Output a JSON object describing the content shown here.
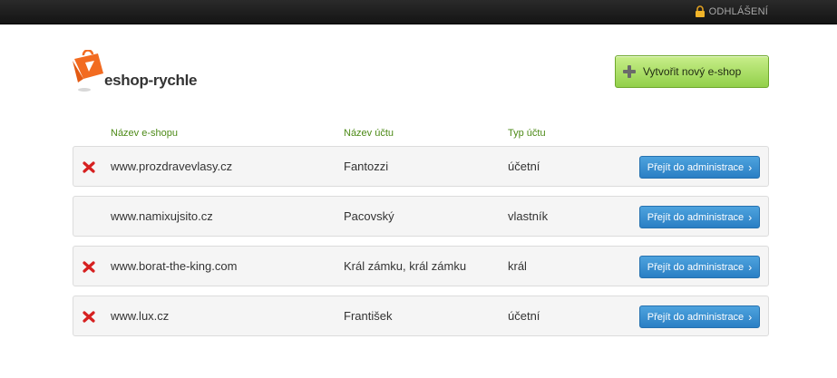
{
  "topbar": {
    "logout_label": "ODHLÁŠENÍ",
    "lock_icon": "lock-icon"
  },
  "logo": {
    "text": "eshop-rychle",
    "icon": "shopping-bag-logo"
  },
  "actions": {
    "new_eshop_label": "Vytvořit nový e-shop",
    "new_icon": "plus-icon"
  },
  "table": {
    "headers": {
      "eshop_name": "Název e-shopu",
      "account_name": "Název účtu",
      "account_type": "Typ účtu"
    },
    "rows": [
      {
        "eshop": "www.prozdravevlasy.cz",
        "account": "Fantozzi",
        "type": "účetní",
        "deletable": true,
        "action": "Přejít do administrace"
      },
      {
        "eshop": "www.namixujsito.cz",
        "account": "Pacovský",
        "type": "vlastník",
        "deletable": false,
        "action": "Přejít do administrace"
      },
      {
        "eshop": "www.borat-the-king.com",
        "account": "Král zámku, král zámku",
        "type": "král",
        "deletable": true,
        "action": "Přejít do administrace"
      },
      {
        "eshop": "www.lux.cz",
        "account": "František",
        "type": "účetní",
        "deletable": true,
        "action": "Přejít do administrace"
      }
    ]
  },
  "colors": {
    "accent_green": "#92d04a",
    "header_green": "#4d8a17",
    "button_blue": "#2a7fc4",
    "delete_red": "#d62020",
    "logo_orange": "#f26b21"
  }
}
